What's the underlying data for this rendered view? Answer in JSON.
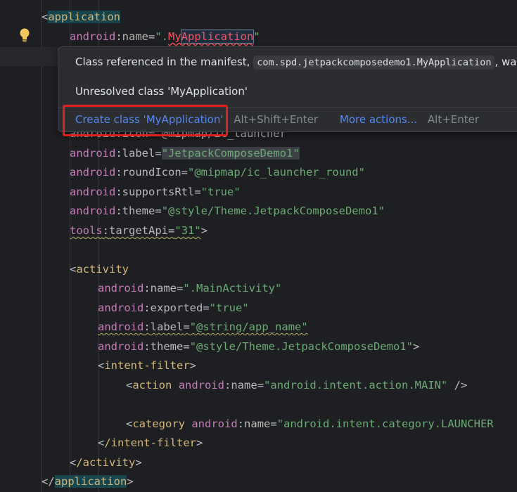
{
  "editor": {
    "lines": {
      "l1_tag": "application",
      "l2_ns": "android",
      "l2_attr": "name",
      "l2_val_pre": "\".",
      "l2_val_my": "My",
      "l2_val_sel": "Application",
      "l2_val_post": "\"",
      "l4_text": "android:icon=\"@mipmap/ic_launcher\"",
      "l5_ns": "android",
      "l5_attr": "label",
      "l5_val": "\"JetpackComposeDemo1\"",
      "l6_ns": "android",
      "l6_attr": "roundIcon",
      "l6_val": "\"@mipmap/ic_launcher_round\"",
      "l7_ns": "android",
      "l7_attr": "supportsRtl",
      "l7_val": "\"true\"",
      "l8_ns": "android",
      "l8_attr": "theme",
      "l8_val": "\"@style/Theme.JetpackComposeDemo1\"",
      "l9_ns": "tools",
      "l9_attr": "targetApi",
      "l9_val": "\"31\"",
      "l11_tag": "activity",
      "l12_ns": "android",
      "l12_attr": "name",
      "l12_val": "\".MainActivity\"",
      "l13_ns": "android",
      "l13_attr": "exported",
      "l13_val": "\"true\"",
      "l14_ns": "android",
      "l14_attr": "label",
      "l14_val": "\"@string/app_name\"",
      "l15_ns": "android",
      "l15_attr": "theme",
      "l15_val": "\"@style/Theme.JetpackComposeDemo1\"",
      "l16_tag": "intent-filter",
      "l17_tag": "action",
      "l17_ns": "android",
      "l17_attr": "name",
      "l17_val": "\"android.intent.action.MAIN\"",
      "l19_tag": "category",
      "l19_ns": "android",
      "l19_attr": "name",
      "l19_val": "\"android.intent.category.LAUNCHER",
      "l20_tag": "/intent-filter",
      "l21_tag": "/activity",
      "l22_tag": "application"
    }
  },
  "popup": {
    "message_pre": "Class referenced in the manifest,",
    "message_code": "com.spd.jetpackcomposedemo1.MyApplication",
    "message_post": ", was n",
    "unresolved": "Unresolved class 'MyApplication'",
    "create_action": "Create class 'MyApplication'",
    "create_shortcut": "Alt+Shift+Enter",
    "more_actions": "More actions...",
    "more_shortcut": "Alt+Enter"
  },
  "colors": {
    "background": "#1e1f22",
    "tag": "#d5b778",
    "string": "#6aab73",
    "namespace": "#c77dbb",
    "link": "#548af7",
    "highlight_box": "#e0201c"
  }
}
